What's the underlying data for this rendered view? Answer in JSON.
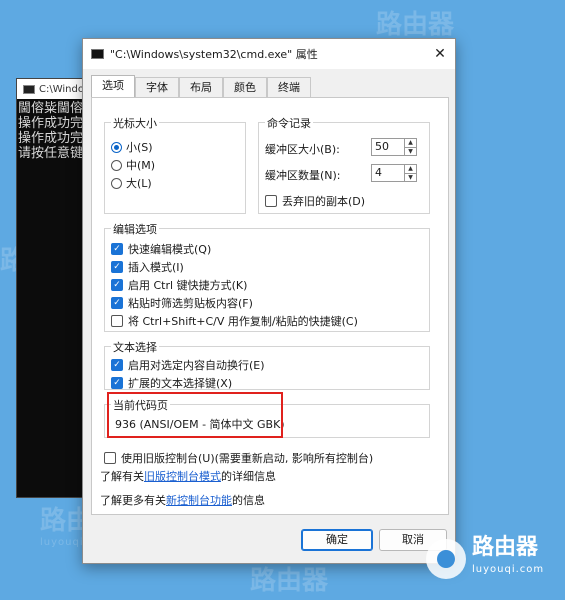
{
  "watermark": {
    "brand": "路由器",
    "domain": "luyouqi.com"
  },
  "console": {
    "title": "C:\\Windo",
    "lines": [
      "閫傛粊閫傛",
      "操作成功完",
      "操作成功完",
      "请按任意键"
    ]
  },
  "dialog": {
    "title": "\"C:\\Windows\\system32\\cmd.exe\" 属性",
    "tabs": [
      "选项",
      "字体",
      "布局",
      "颜色",
      "终端"
    ],
    "cursor_size": {
      "title": "光标大小",
      "options": [
        "小(S)",
        "中(M)",
        "大(L)"
      ],
      "selected": "小(S)"
    },
    "history": {
      "title": "命令记录",
      "buffer_size_label": "缓冲区大小(B):",
      "buffer_size": "50",
      "buffer_count_label": "缓冲区数量(N):",
      "buffer_count": "4",
      "discard_label": "丢弃旧的副本(D)"
    },
    "edit_options": {
      "title": "编辑选项",
      "items": [
        {
          "label": "快速编辑模式(Q)",
          "checked": true
        },
        {
          "label": "插入模式(I)",
          "checked": true
        },
        {
          "label": "启用 Ctrl 键快捷方式(K)",
          "checked": true
        },
        {
          "label": "粘贴时筛选剪贴板内容(F)",
          "checked": true
        },
        {
          "label": "将 Ctrl+Shift+C/V 用作复制/粘贴的快捷键(C)",
          "checked": false
        }
      ]
    },
    "text_selection": {
      "title": "文本选择",
      "items": [
        {
          "label": "启用对选定内容自动换行(E)",
          "checked": true
        },
        {
          "label": "扩展的文本选择键(X)",
          "checked": true
        }
      ]
    },
    "codepage": {
      "title": "当前代码页",
      "value": "936   (ANSI/OEM - 简体中文 GBK)"
    },
    "legacy_label": "使用旧版控制台(U)(需要重新启动, 影响所有控制台)",
    "legacy_info": {
      "prefix": "了解有关",
      "link": "旧版控制台模式",
      "suffix": "的详细信息"
    },
    "new_info": {
      "prefix": "了解更多有关",
      "link": "新控制台功能",
      "suffix": "的信息"
    },
    "ok_label": "确定",
    "cancel_label": "取消"
  },
  "colors": {
    "accent": "#1a73d6",
    "highlight": "#e0211d",
    "desktop": "#5ea9e2"
  }
}
